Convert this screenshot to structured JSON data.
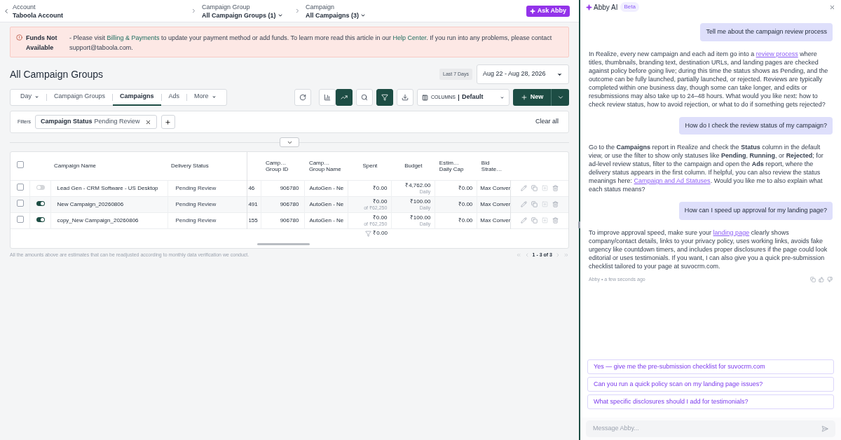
{
  "topbar": {
    "crumbs": [
      {
        "label": "Account",
        "value": "Taboola Account",
        "dropdown": false
      },
      {
        "label": "Campaign Group",
        "value": "All Campaign Groups (1)",
        "dropdown": true
      },
      {
        "label": "Campaign",
        "value": "All Campaigns (3)",
        "dropdown": true
      }
    ],
    "ask_button": "Ask Abby"
  },
  "alert": {
    "title": "Funds Not Available",
    "message": [
      {
        "kind": "text",
        "text": "- Please visit "
      },
      {
        "kind": "link",
        "text": "Billing & Payments"
      },
      {
        "kind": "text",
        "text": " to update your payment method or add funds. To learn more read this article in our "
      },
      {
        "kind": "link",
        "text": "Help Center"
      },
      {
        "kind": "text",
        "text": ". If you run into any problems, please contact support@taboola.com."
      }
    ]
  },
  "page": {
    "title": "All Campaign Groups",
    "range_label": "Last 7 Days",
    "date_range": "Aug 22 - Aug 28, 2026"
  },
  "tabs": [
    {
      "label": "Day",
      "dropdown": true,
      "selected": false
    },
    {
      "label": "Campaign Groups",
      "dropdown": false,
      "selected": false
    },
    {
      "label": "Campaigns",
      "dropdown": false,
      "selected": true
    },
    {
      "label": "Ads",
      "dropdown": false,
      "selected": false
    },
    {
      "label": "More",
      "dropdown": true,
      "selected": false
    }
  ],
  "toolbar": {
    "bar_chart_selected": false,
    "line_chart_selected": true,
    "filter_active": true,
    "columns_label": "COLUMNS",
    "columns_value": "Default",
    "new_button": "New"
  },
  "filters": {
    "label": "Filters",
    "chips": [
      {
        "name": "Campaign Status",
        "value": "Pending Review"
      }
    ],
    "clear": "Clear all"
  },
  "table": {
    "all_checked": false,
    "columns": [
      "Campaign Name",
      "Delivery Status",
      "Camp… Group ID",
      "Camp… Group Name",
      "Spent",
      "Budget",
      "Estim… Daily Cap",
      "Bid Strate…"
    ],
    "rows": [
      {
        "checked": false,
        "on": false,
        "name": "Lead Gen - CRM Software - US Desktop",
        "delivery_status": "Pending Review",
        "column_3": "46",
        "group_id": "906780",
        "group_name": "AutoGen - Ne",
        "spent": "₹0.00",
        "budget": "₹4,762.00",
        "budget_sub": "Daily",
        "daily_cap": "₹0.00",
        "bid_strategy": "Max Conver"
      },
      {
        "checked": false,
        "on": true,
        "name": "New Campaign_20260806",
        "delivery_status": "Pending Review",
        "column_3": "491",
        "group_id": "906780",
        "group_name": "AutoGen - Ne",
        "spent": "₹0.00",
        "spent_sub": "of ₹62,250",
        "budget": "₹100.00",
        "budget_sub": "Daily",
        "daily_cap": "₹0.00",
        "bid_strategy": "Max Conver"
      },
      {
        "checked": false,
        "on": true,
        "name": "copy_New Campaign_20260806",
        "delivery_status": "Pending Review",
        "column_3": "155",
        "group_id": "906780",
        "group_name": "AutoGen - Ne",
        "spent": "₹0.00",
        "spent_sub": "of ₹62,250",
        "budget": "₹100.00",
        "budget_sub": "Daily",
        "daily_cap": "₹0.00",
        "bid_strategy": "Max Conver"
      }
    ],
    "total_spent": "₹0.00",
    "pagination": "1 - 3 of 3"
  },
  "note": "All the amounts above are estimates that can be readjusted according to monthly data verification we conduct.",
  "chat": {
    "title": "Abby AI",
    "badge": "Beta",
    "messages": [
      {
        "kind": "user",
        "parts": [
          {
            "kind": "text",
            "text": "Tell me about the campaign review process"
          }
        ]
      },
      {
        "kind": "assistant",
        "parts": [
          {
            "kind": "text",
            "text": "In Realize, every new campaign and each ad item go into a "
          },
          {
            "kind": "link",
            "text": "review process"
          },
          {
            "kind": "text",
            "text": " where titles, thumbnails, branding text, destination URLs, and landing pages are checked against policy before going live; during this time the status shows as Pending, and the outcome can be fully launched, partially launched, or rejected. Reviews are typically completed within one business day, though some can take longer, and edits or resubmissions may also take up to 24–48 hours. What would you like next: how to check review status, how to avoid rejection, or what to do if something gets rejected?"
          }
        ]
      },
      {
        "kind": "user",
        "parts": [
          {
            "kind": "text",
            "text": "How do I check the review status of my campaign?"
          }
        ]
      },
      {
        "kind": "assistant",
        "parts": [
          {
            "kind": "text",
            "text": "Go to the **Campaigns** report in Realize and check the **Status** column in the default view, or use the filter to show only statuses like **Pending**, **Running**, or **Rejected**; for ad-level review status, filter to the campaign and open the **Ads** report, where the delivery status appears in the first column. If helpful, you can also review the status meanings here: "
          },
          {
            "kind": "link",
            "text": "Campaign and Ad Statuses"
          },
          {
            "kind": "text",
            "text": ". Would you like me to also explain what each status means?"
          }
        ]
      },
      {
        "kind": "user",
        "parts": [
          {
            "kind": "text",
            "text": "How can I speed up approval for my landing page?"
          }
        ]
      },
      {
        "kind": "assistant",
        "parts": [
          {
            "kind": "text",
            "text": "To improve approval speed, make sure your "
          },
          {
            "kind": "link",
            "text": "landing page"
          },
          {
            "kind": "text",
            "text": " clearly shows company/contact details, links to your privacy policy, uses working links, avoids fake urgency like countdown timers, and includes proper disclosures if the page could look editorial or uses testimonials. If you want, I can also give you a quick pre-submission checklist tailored to your page at suvocrm.com."
          }
        ]
      }
    ],
    "meta": "Abby • a few seconds ago",
    "suggestions": [
      "Yes — give me the pre-submission checklist for suvocrm.com",
      "Can you run a quick policy scan on my landing page issues?",
      "What specific disclosures should I add for testimonials?"
    ],
    "input": {
      "placeholder": "Message Abby..."
    }
  }
}
